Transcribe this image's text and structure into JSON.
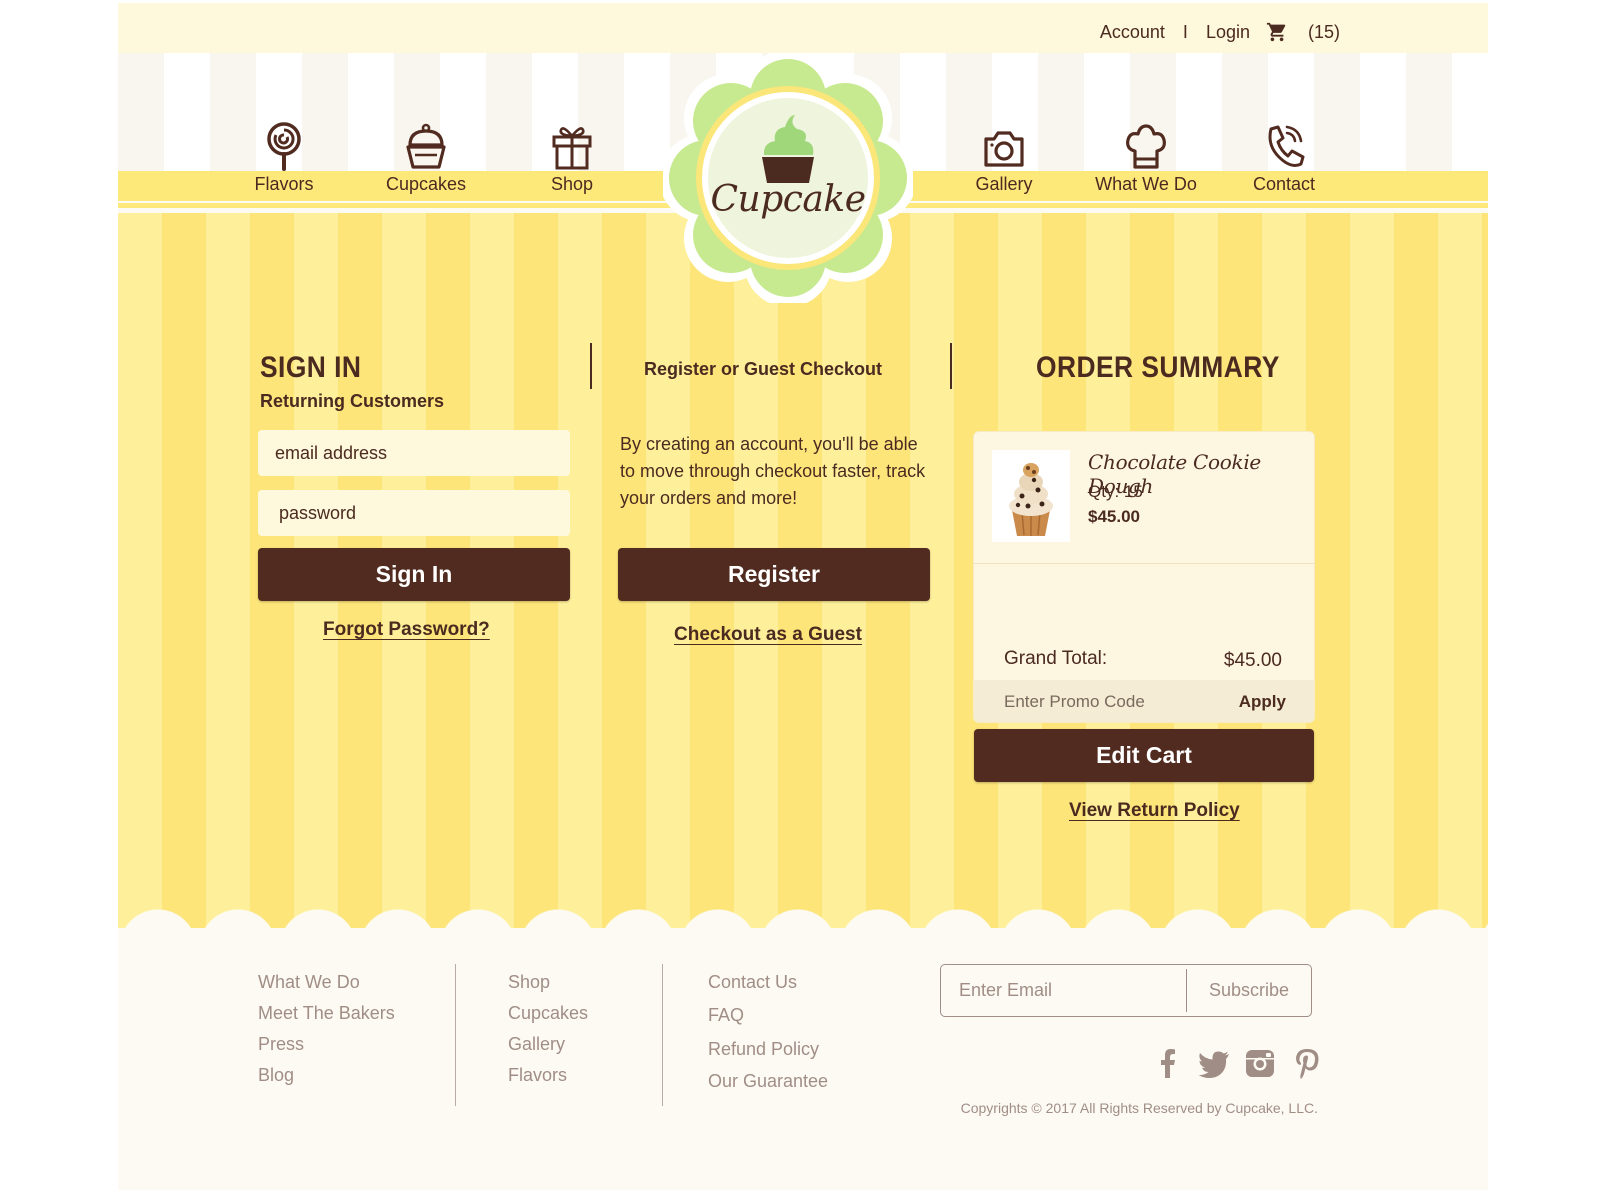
{
  "topbar": {
    "account": "Account",
    "separator": "I",
    "login": "Login",
    "cart_icon": "shopping-cart-icon",
    "cart_count": "(15)"
  },
  "nav": {
    "left": [
      {
        "label": "Flavors",
        "icon": "lollipop-icon"
      },
      {
        "label": "Cupcakes",
        "icon": "cupcake-icon"
      },
      {
        "label": "Shop",
        "icon": "gift-icon"
      }
    ],
    "right": [
      {
        "label": "Gallery",
        "icon": "camera-icon"
      },
      {
        "label": "What We Do",
        "icon": "chef-hat-icon"
      },
      {
        "label": "Contact",
        "icon": "phone-icon"
      }
    ]
  },
  "logo": {
    "text": "Cupcake"
  },
  "signin": {
    "title": "SIGN IN",
    "subtitle": "Returning Customers",
    "email_placeholder": "email address",
    "password_placeholder": "password",
    "button": "Sign In",
    "forgot": "Forgot Password?"
  },
  "register": {
    "title": "Register or Guest Checkout",
    "text": "By creating an account, you'll be able to move through checkout faster, track your orders and more!",
    "button": "Register",
    "guest": "Checkout as a Guest"
  },
  "order_summary": {
    "title": "ORDER SUMMARY",
    "item": {
      "name": "Chocolate Cookie Dough",
      "qty": "Qty: 15",
      "price": "$45.00"
    },
    "grand_total_label": "Grand Total:",
    "grand_total_value": "$45.00",
    "promo_placeholder": "Enter Promo Code",
    "apply": "Apply",
    "edit_cart": "Edit Cart",
    "return_policy": "View Return Policy"
  },
  "footer": {
    "col1": [
      "What We Do",
      "Meet The Bakers",
      "Press",
      "Blog"
    ],
    "col2": [
      "Shop",
      "Cupcakes",
      "Gallery",
      "Flavors"
    ],
    "col3": [
      "Contact Us",
      "FAQ",
      "Refund Policy",
      "Our Guarantee"
    ],
    "email_placeholder": "Enter Email",
    "subscribe": "Subscribe",
    "social": [
      "facebook-icon",
      "twitter-icon",
      "instagram-icon",
      "pinterest-icon"
    ],
    "copyright": "Copyrights © 2017 All Rights Reserved by Cupcake, LLC."
  },
  "colors": {
    "brown": "#512b20",
    "yellow_light": "#fef09a",
    "yellow_dark": "#fde57a",
    "green": "#c7e98f",
    "cream": "#fdf7e2",
    "footer_text": "#a08e86"
  }
}
